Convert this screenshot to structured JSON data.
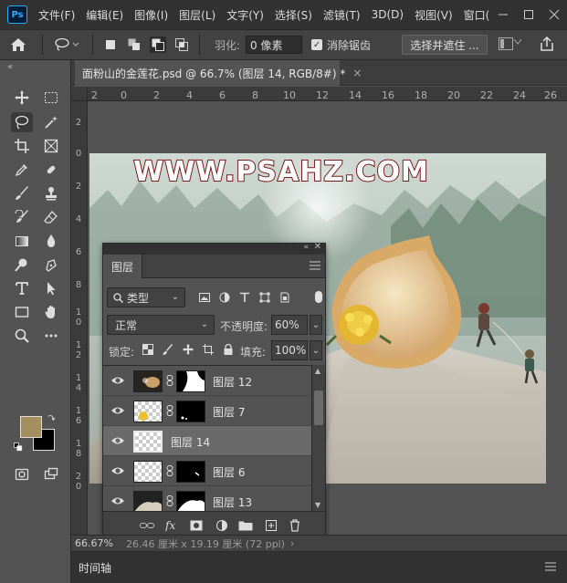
{
  "app": {
    "logo_text": "Ps",
    "menu": [
      "文件(F)",
      "编辑(E)",
      "图像(I)",
      "图层(L)",
      "文字(Y)",
      "选择(S)",
      "滤镜(T)",
      "3D(D)",
      "视图(V)",
      "窗口("
    ],
    "window_controls": [
      "minimize",
      "maximize",
      "close"
    ]
  },
  "options": {
    "feather_label": "羽化:",
    "feather_value": "0 像素",
    "antialias_label": "消除锯齿",
    "antialias_checked": true,
    "select_mask_label": "选择并遮住 ..."
  },
  "document": {
    "tab_title": "面粉山的金莲花.psd @ 66.7% (图层 14, RGB/8#) *",
    "close_glyph": "×",
    "canvas_text": "WWW.PSAHZ.COM"
  },
  "rulers": {
    "horizontal": [
      "2",
      "0",
      "2",
      "4",
      "6",
      "8",
      "10",
      "12",
      "14",
      "16",
      "18",
      "20",
      "22",
      "24",
      "26"
    ],
    "vertical": [
      "2",
      "0",
      "2",
      "4",
      "6",
      "8",
      "1 0",
      "1 2",
      "1 4",
      "1 6",
      "1 8",
      "2 0"
    ]
  },
  "colors": {
    "foreground": "#a48f5f",
    "background": "#000000"
  },
  "status": {
    "zoom": "66.67%",
    "doc_info": "26.46 厘米 x 19.19 厘米 (72 ppi)"
  },
  "timeline": {
    "label": "时间轴"
  },
  "layers_panel": {
    "tab_label": "图层",
    "filter_label": "类型",
    "blend_mode": "正常",
    "opacity_label": "不透明度:",
    "opacity_value": "60%",
    "lock_label": "锁定:",
    "fill_label": "填充:",
    "fill_value": "100%",
    "layers": [
      {
        "name": "图层 12",
        "has_mask": true,
        "selected": false
      },
      {
        "name": "图层 7",
        "has_mask": true,
        "selected": false
      },
      {
        "name": "图层 14",
        "has_mask": false,
        "selected": true
      },
      {
        "name": "图层 6",
        "has_mask": true,
        "selected": false
      },
      {
        "name": "图层 13",
        "has_mask": true,
        "selected": false
      }
    ]
  }
}
